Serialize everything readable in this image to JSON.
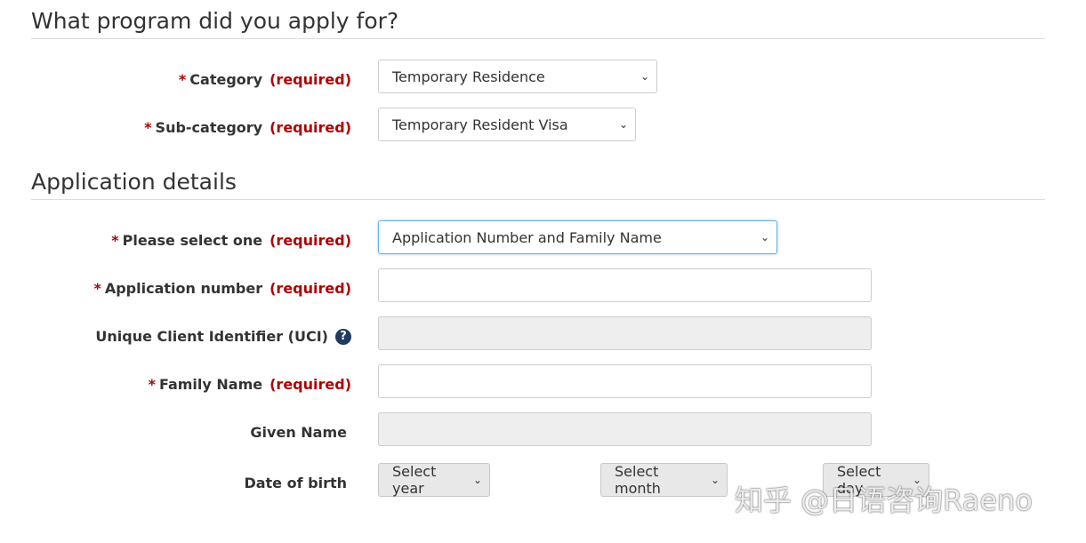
{
  "sections": {
    "program_title": "What program did you apply for?",
    "details_title": "Application details"
  },
  "required_text": "(required)",
  "fields": {
    "category": {
      "label": "Category",
      "value": "Temporary Residence"
    },
    "subcategory": {
      "label": "Sub-category",
      "value": "Temporary Resident Visa"
    },
    "select_one": {
      "label": "Please select one",
      "value": "Application Number and Family Name"
    },
    "application_number": {
      "label": "Application number",
      "value": ""
    },
    "uci": {
      "label": "Unique Client Identifier (UCI)",
      "value": "",
      "help_icon": "question-circle-icon"
    },
    "family_name": {
      "label": "Family Name",
      "value": ""
    },
    "given_name": {
      "label": "Given Name",
      "value": ""
    },
    "dob": {
      "label": "Date of birth",
      "year": "Select year",
      "month": "Select month",
      "day": "Select day"
    }
  },
  "watermark": "知乎 @日语咨询Raeno"
}
